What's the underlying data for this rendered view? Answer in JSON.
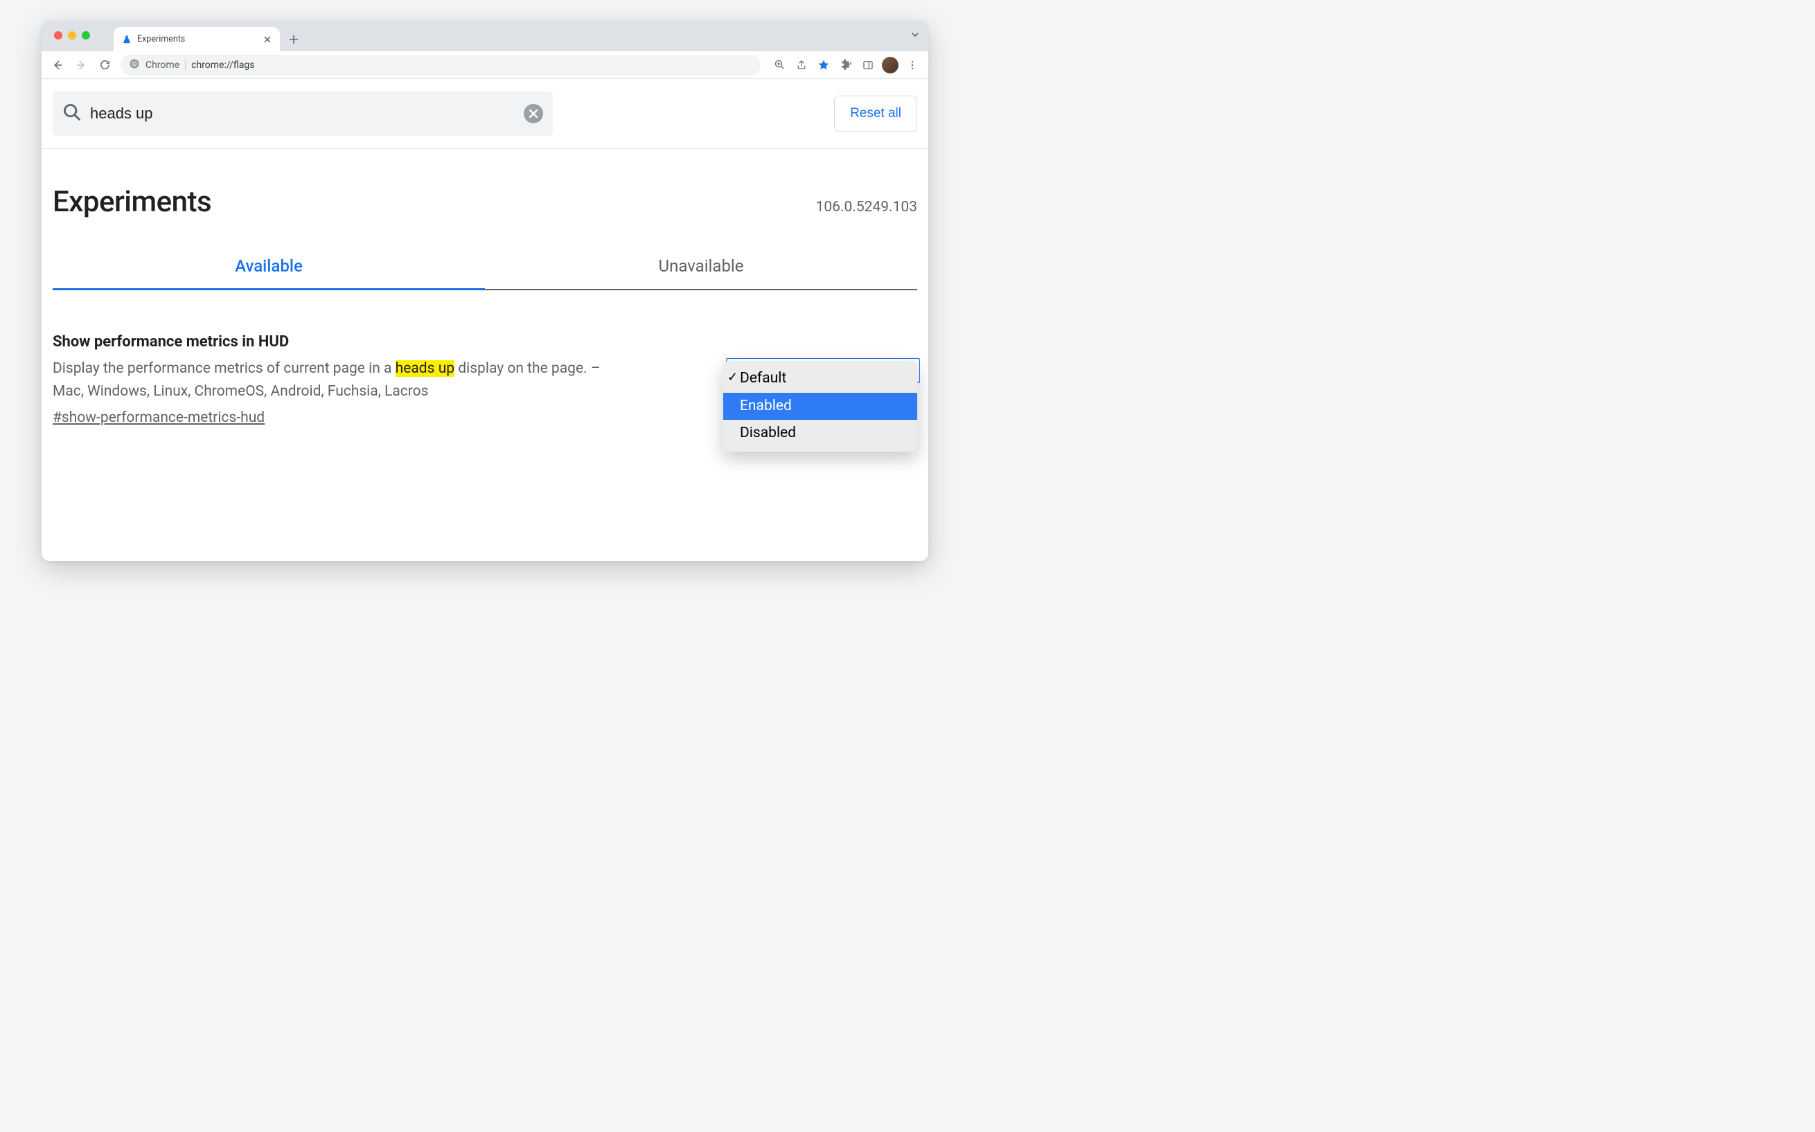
{
  "browser": {
    "tab_title": "Experiments",
    "omnibox_chip": "Chrome",
    "omnibox_url": "chrome://flags"
  },
  "flags_page": {
    "search_value": "heads up",
    "reset_label": "Reset all",
    "title": "Experiments",
    "version": "106.0.5249.103",
    "tabs": {
      "available": "Available",
      "unavailable": "Unavailable"
    },
    "flag": {
      "title": "Show performance metrics in HUD",
      "desc_pre": "Display the performance metrics of current page in a ",
      "desc_highlight": "heads up",
      "desc_post": " display on the page. – Mac, Windows, Linux, ChromeOS, Android, Fuchsia, Lacros",
      "anchor": "#show-performance-metrics-hud",
      "options": {
        "default": "Default",
        "enabled": "Enabled",
        "disabled": "Disabled"
      }
    }
  }
}
